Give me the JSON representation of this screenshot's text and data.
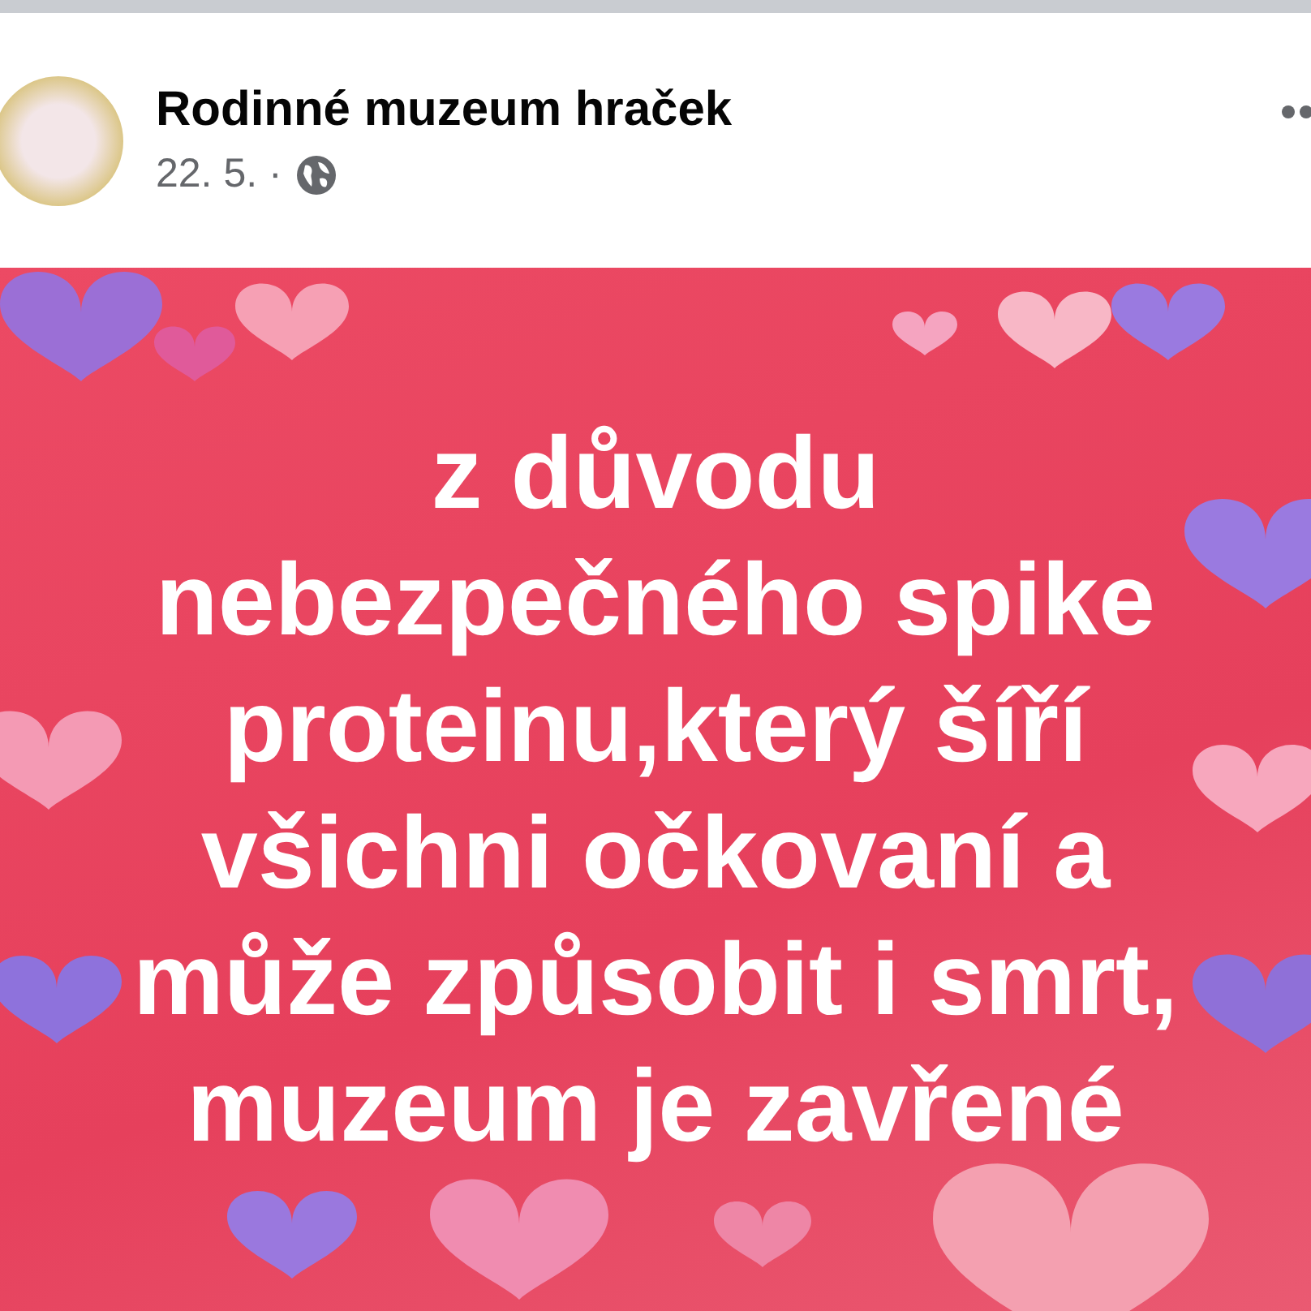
{
  "post": {
    "author": "Rodinné muzeum hraček",
    "date": "22. 5. ·",
    "text": "z důvodu\nnebezpečného spike\nproteinu,který šíří\nvšichni očkovaní a\nmůže způsobit i smrt,\nmuzeum je zavřené"
  }
}
